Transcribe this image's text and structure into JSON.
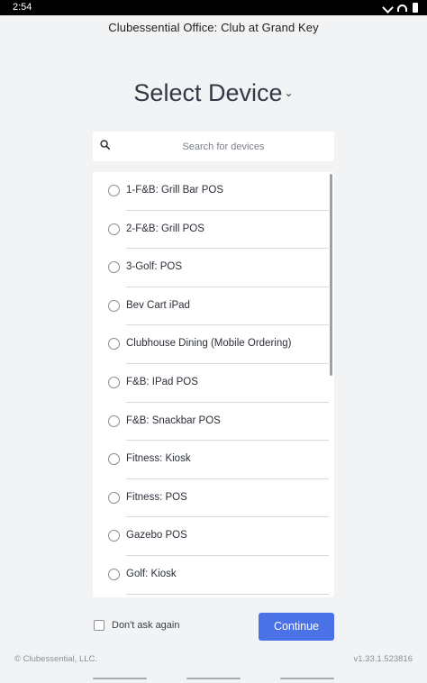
{
  "status_bar": {
    "time": "2:54",
    "icons": [
      "mute-icon",
      "wifi-icon",
      "battery-icon"
    ]
  },
  "header": {
    "title": "Clubessential Office: Club at Grand Key"
  },
  "page": {
    "title": "Select Device",
    "title_chevron": "⌄"
  },
  "search": {
    "placeholder": "Search for devices",
    "value": ""
  },
  "devices": [
    {
      "label": "1-F&B: Grill Bar POS",
      "selected": false
    },
    {
      "label": "2-F&B: Grill POS",
      "selected": false
    },
    {
      "label": "3-Golf: POS",
      "selected": false
    },
    {
      "label": "Bev Cart iPad",
      "selected": false
    },
    {
      "label": "Clubhouse Dining (Mobile Ordering)",
      "selected": false
    },
    {
      "label": "F&B: IPad POS",
      "selected": false
    },
    {
      "label": "F&B: Snackbar POS",
      "selected": false
    },
    {
      "label": "Fitness: Kiosk",
      "selected": false
    },
    {
      "label": "Fitness: POS",
      "selected": false
    },
    {
      "label": "Gazebo POS",
      "selected": false
    },
    {
      "label": "Golf: Kiosk",
      "selected": false
    }
  ],
  "dont_ask": {
    "label": "Don't ask again",
    "checked": false
  },
  "continue_button": {
    "label": "Continue"
  },
  "footer": {
    "copyright": "© Clubessential, LLC.",
    "version": "v1.33.1.523816"
  },
  "colors": {
    "accent": "#4a72e6",
    "background": "#f2f3f5"
  }
}
